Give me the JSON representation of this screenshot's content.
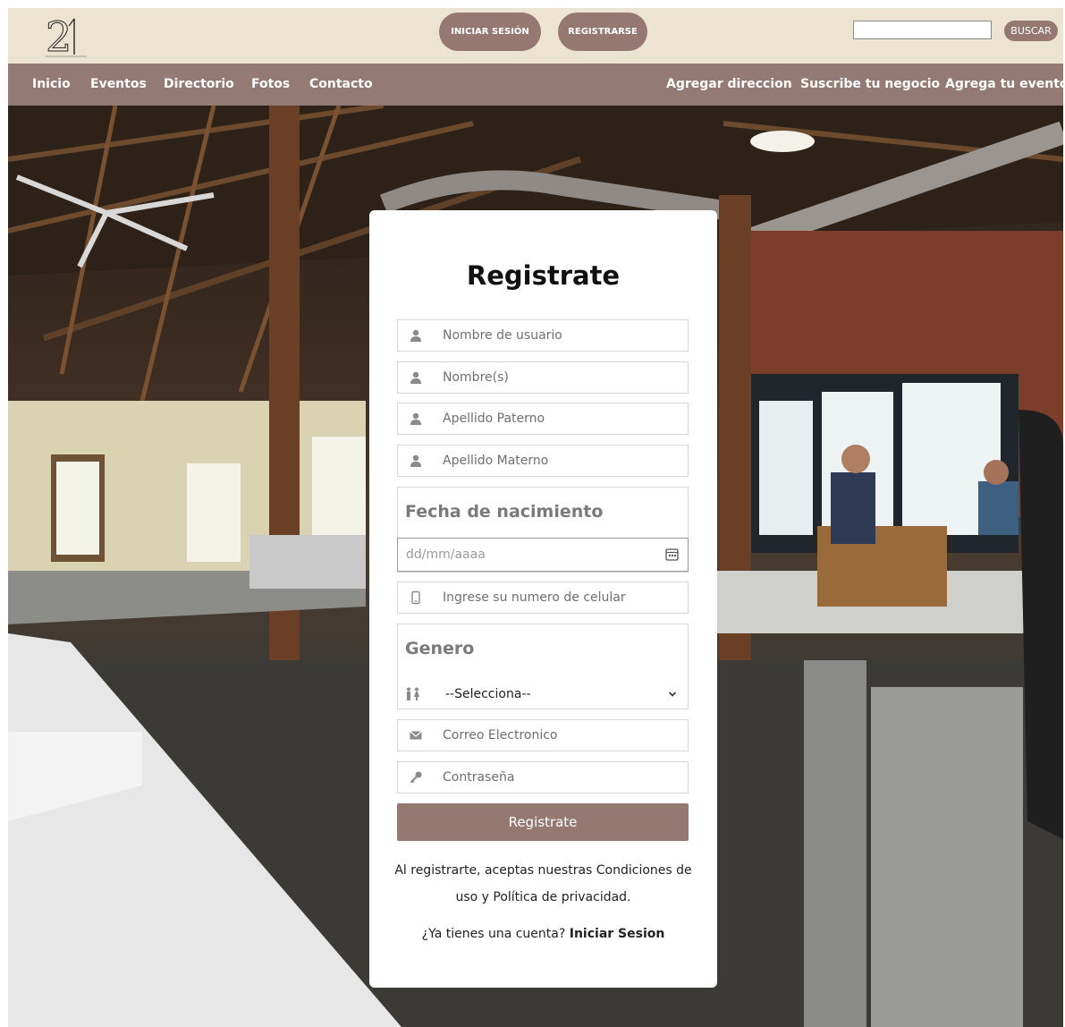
{
  "header": {
    "logo_text": "21",
    "login_button": "INICIAR SESIÓN",
    "register_button": "REGISTRARSE",
    "search_value": "",
    "search_button": "BUSCAR"
  },
  "nav": {
    "left": [
      "Inicio",
      "Eventos",
      "Directorio",
      "Fotos",
      "Contacto"
    ],
    "right": [
      "Agregar direccion",
      "Suscribe tu negocio",
      "Agrega tu evento"
    ]
  },
  "form": {
    "title": "Registrate",
    "username_placeholder": "Nombre de usuario",
    "name_placeholder": "Nombre(s)",
    "paternal_placeholder": "Apellido Paterno",
    "maternal_placeholder": "Apellido Materno",
    "birthdate_label": "Fecha de nacimiento",
    "birthdate_placeholder": "dd/mm/aaaa",
    "phone_placeholder": "Ingrese su numero de celular",
    "gender_label": "Genero",
    "gender_selected": "--Selecciona--",
    "email_placeholder": "Correo Electronico",
    "password_placeholder": "Contraseña",
    "submit_label": "Registrate",
    "terms_text": "Al registrarte, aceptas nuestras Condiciones de uso y Política de privacidad.",
    "have_account_text": "¿Ya tienes una cuenta?",
    "login_link": "Iniciar Sesion"
  },
  "colors": {
    "accent": "#957971",
    "nav_bg": "#937a73",
    "topbar_bg": "#ede3d1"
  }
}
